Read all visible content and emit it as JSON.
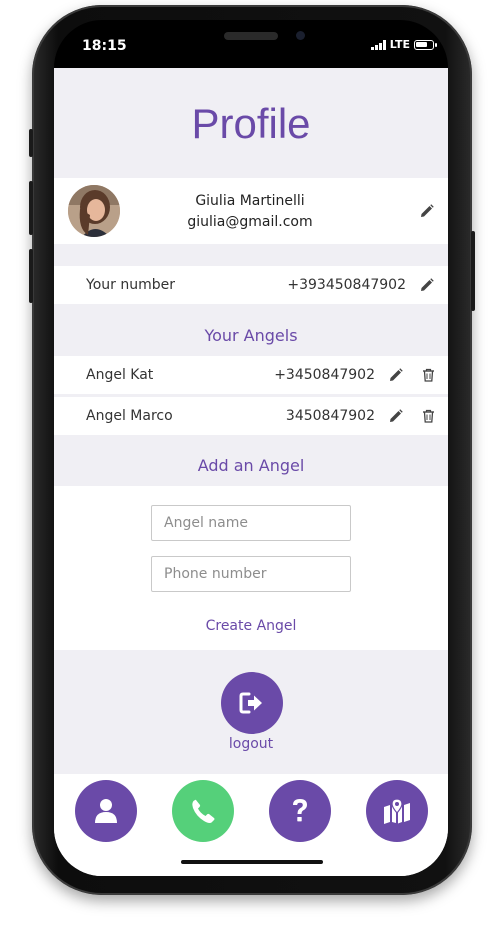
{
  "status_bar": {
    "time": "18:15",
    "network": "LTE"
  },
  "page": {
    "title": "Profile"
  },
  "profile": {
    "name": "Giulia Martinelli",
    "email": "giulia@gmail.com"
  },
  "your_number": {
    "label": "Your number",
    "value": "+393450847902"
  },
  "angels_section": {
    "title": "Your Angels",
    "items": [
      {
        "name": "Angel Kat",
        "phone": "+3450847902"
      },
      {
        "name": "Angel Marco",
        "phone": "3450847902"
      }
    ]
  },
  "add_angel": {
    "title": "Add an Angel",
    "name_placeholder": "Angel name",
    "phone_placeholder": "Phone number",
    "create_label": "Create Angel"
  },
  "logout": {
    "label": "logout"
  },
  "bottom_nav": [
    {
      "icon": "user-icon",
      "color": "#6a4aa8"
    },
    {
      "icon": "phone-icon",
      "color": "#55d07a"
    },
    {
      "icon": "question-icon",
      "color": "#6a4aa8"
    },
    {
      "icon": "map-marker-icon",
      "color": "#6a4aa8"
    }
  ],
  "colors": {
    "accent": "#6a4aa8",
    "call": "#55d07a",
    "background": "#f0eff4"
  }
}
